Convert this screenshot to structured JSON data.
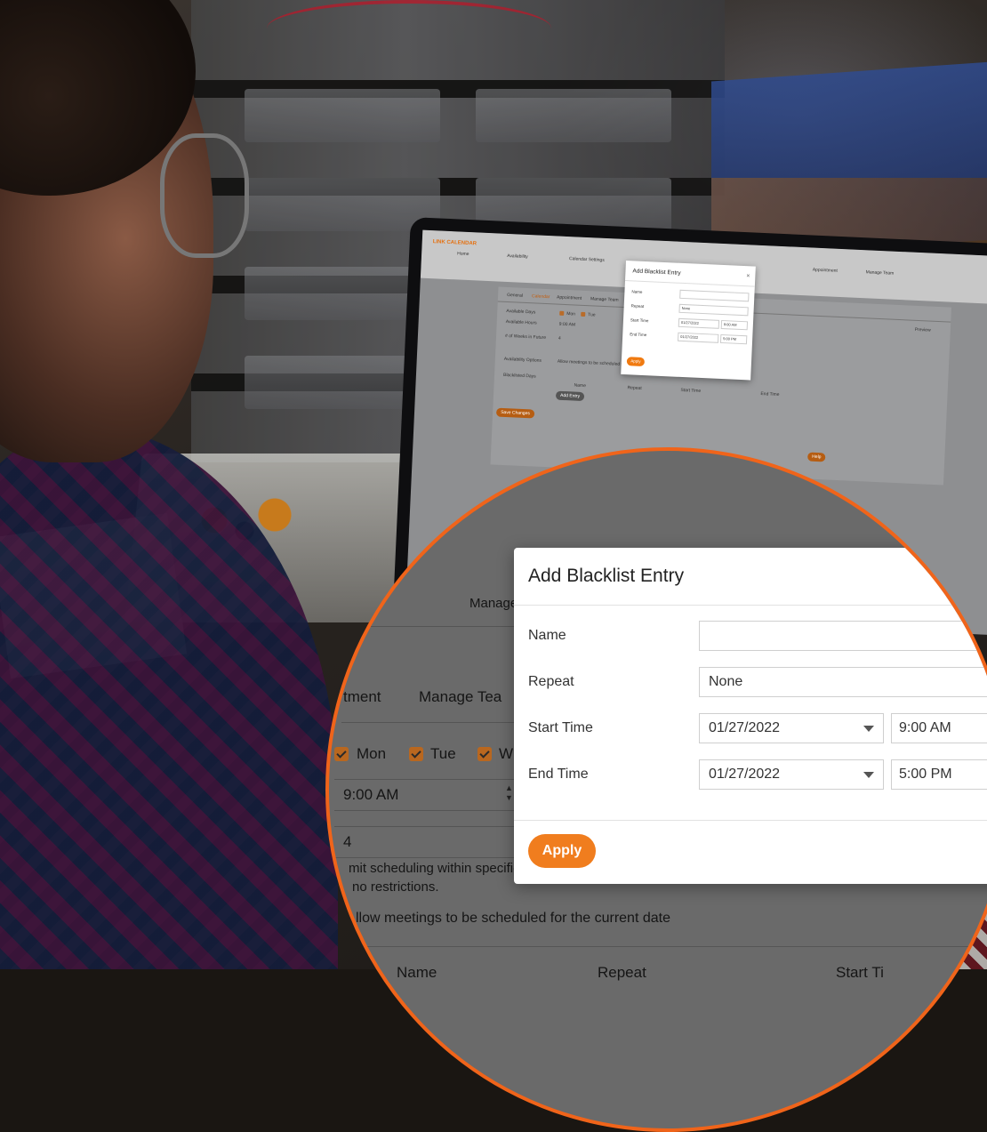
{
  "laptop": {
    "brand": "LINK CALENDAR",
    "nav": [
      "Home",
      "Availability",
      "Calendar Settings",
      "Appointment",
      "Manage Team"
    ],
    "tabs": [
      "General",
      "Calendar",
      "Appointment",
      "Manage Team"
    ],
    "labels": {
      "available_days": "Available Days",
      "available_hours": "Available Hours",
      "weeks_future": "# of Weeks in Future",
      "availability_options": "Availability Options",
      "blacklisted_days": "Blacklisted Days",
      "preview": "Preview"
    },
    "days": [
      "Mon",
      "Tue"
    ],
    "hours_value": "9:00 AM",
    "weeks_value": "4",
    "options_text": "Allow meetings to be scheduled for the current date",
    "blacklist_headers": [
      "Name",
      "Repeat",
      "Start Time",
      "End Time"
    ],
    "add_entry": "Add Entry",
    "save_changes": "Save Changes",
    "help": "Help",
    "dialog": {
      "title": "Add Blacklist Entry",
      "name_label": "Name",
      "repeat_label": "Repeat",
      "repeat_value": "None",
      "start_label": "Start Time",
      "start_date": "01/27/2022",
      "start_time": "9:00 AM",
      "end_label": "End Time",
      "end_date": "01/27/2022",
      "end_time": "5:00 PM",
      "apply": "Apply"
    }
  },
  "zoom": {
    "background": {
      "manage": "Manage",
      "tab_appointment": "tment",
      "tab_manage_team": "Manage Tea",
      "day_mon": "Mon",
      "day_tue": "Tue",
      "day_wed": "W",
      "hours_value": "9:00 AM",
      "weeks_value": "4",
      "note_line1": "mit scheduling within specifie",
      "note_line2": "no restrictions.",
      "allow_text": "llow meetings to be scheduled for the current date",
      "col_name": "Name",
      "col_repeat": "Repeat",
      "col_start": "Start Ti"
    },
    "dialog": {
      "title": "Add Blacklist Entry",
      "name_label": "Name",
      "name_value": "",
      "repeat_label": "Repeat",
      "repeat_value": "None",
      "start_label": "Start Time",
      "start_date": "01/27/2022",
      "start_time": "9:00 AM",
      "end_label": "End Time",
      "end_date": "01/27/2022",
      "end_time": "5:00 PM",
      "apply": "Apply"
    }
  },
  "colors": {
    "accent": "#f07d1e",
    "ring": "#f0641a",
    "checkbox": "#b9671f"
  }
}
